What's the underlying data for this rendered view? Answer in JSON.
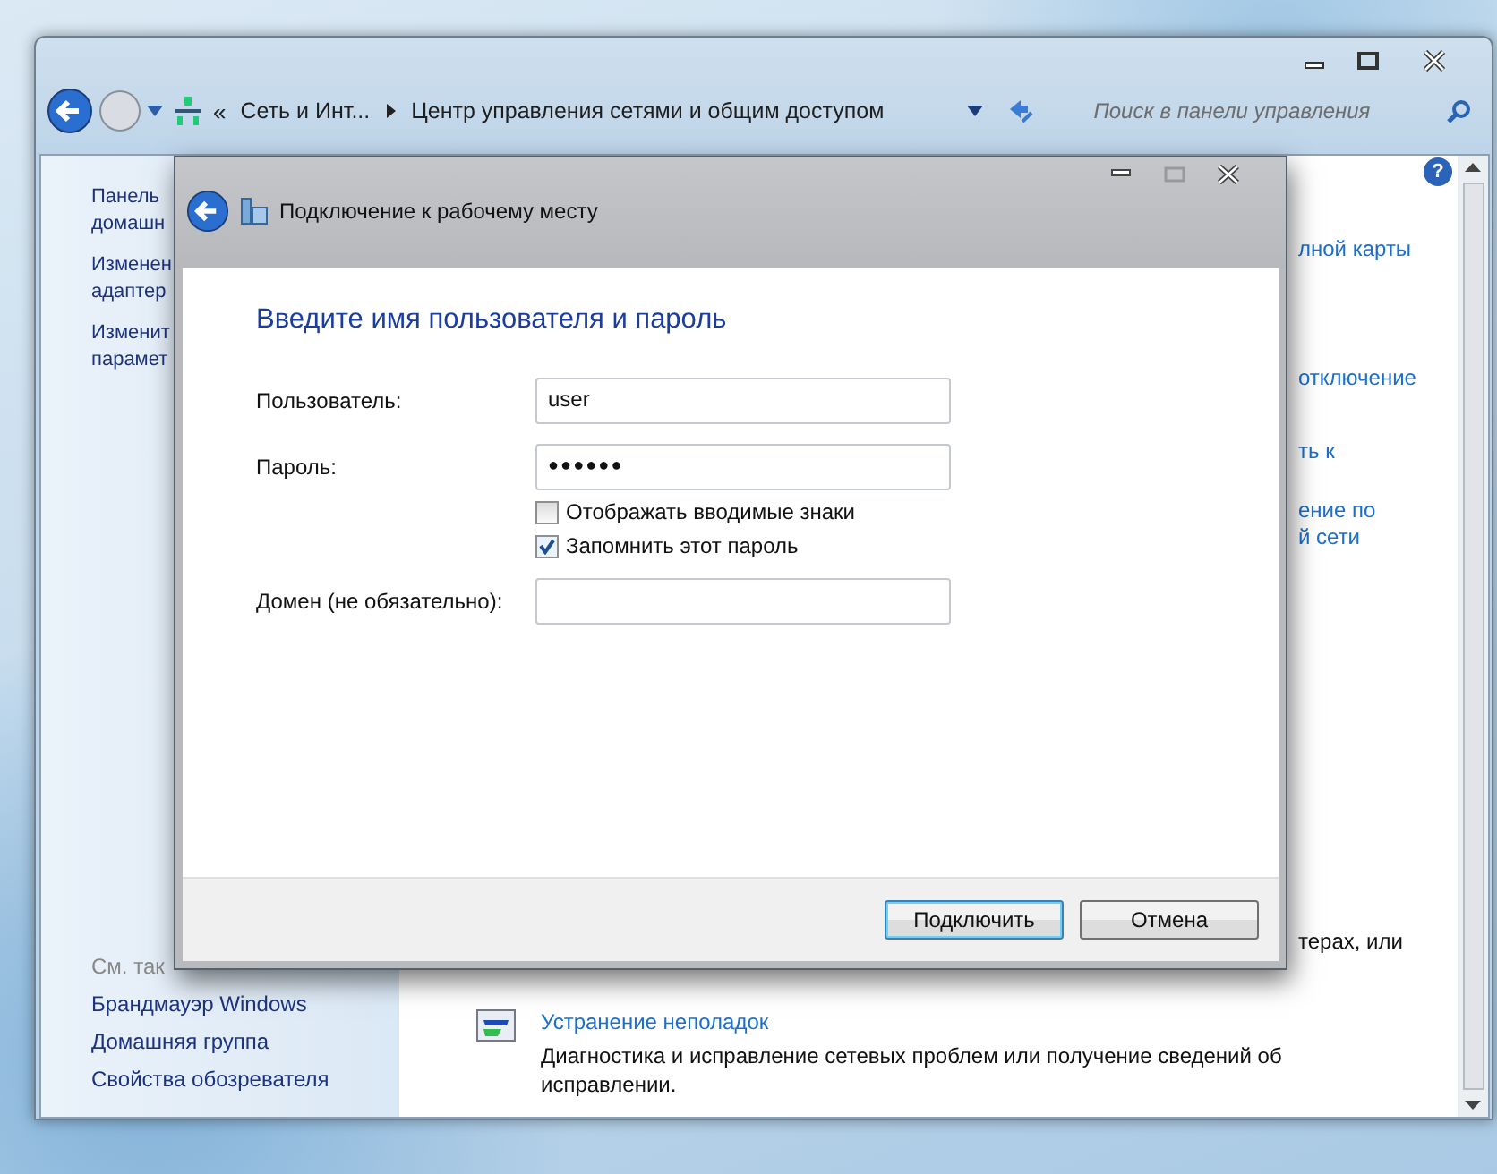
{
  "explorer": {
    "chevron": "«",
    "help": "?",
    "breadcrumb": [
      "Сеть и Инт...",
      "Центр управления сетями и общим доступом"
    ],
    "search": {
      "placeholder": "Поиск в панели управления"
    }
  },
  "sidebar": {
    "links": [
      {
        "lines": [
          "Панель",
          "домашн"
        ]
      },
      {
        "lines": [
          "Изменен",
          "адаптер"
        ]
      },
      {
        "lines": [
          "Изменит",
          "парамет"
        ]
      }
    ],
    "see_also": {
      "heading": "См. так",
      "links": [
        "Брандмауэр Windows",
        "Домашняя группа",
        "Свойства обозревателя"
      ]
    }
  },
  "main": {
    "fragments": [
      {
        "text": "лной карты",
        "kind": "link"
      },
      {
        "text": "отключение",
        "kind": "link"
      },
      {
        "text": "ть к",
        "kind": "link"
      },
      {
        "text": "ение по",
        "kind": "link"
      },
      {
        "text": "й сети",
        "kind": "link"
      },
      {
        "text": "терах, или",
        "kind": "text"
      }
    ],
    "troubleshoot": {
      "title": "Устранение неполадок",
      "description": "Диагностика и исправление сетевых проблем или получение сведений об исправлении."
    }
  },
  "dialog": {
    "title": "Подключение к рабочему месту",
    "heading": "Введите имя пользователя и пароль",
    "fields": [
      {
        "label": "Пользователь:",
        "value": "user",
        "kind": "text"
      },
      {
        "label": "Пароль:",
        "value": "●●●●●●",
        "kind": "password"
      }
    ],
    "checkboxes": [
      {
        "label": "Отображать вводимые знаки",
        "checked": false
      },
      {
        "label": "Запомнить этот пароль",
        "checked": true
      }
    ],
    "domain": {
      "label": "Домен (не обязательно):"
    },
    "buttons": [
      {
        "label": "Подключить",
        "default": true
      },
      {
        "label": "Отмена",
        "default": false
      }
    ]
  }
}
